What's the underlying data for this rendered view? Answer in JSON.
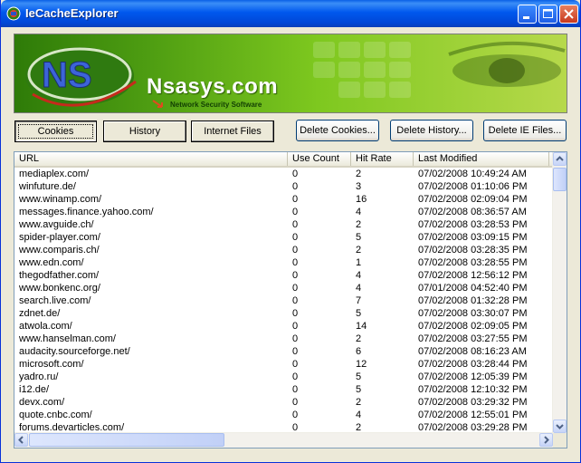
{
  "window": {
    "title": "IeCacheExplorer"
  },
  "banner": {
    "logo_text": "NS",
    "brand": "Nsasys.com",
    "tagline": "Network Security Software"
  },
  "buttons": {
    "cookies": "Cookies",
    "history": "History",
    "internet_files": "Internet Files",
    "delete_cookies": "Delete Cookies...",
    "delete_history": "Delete History...",
    "delete_ie_files": "Delete IE Files..."
  },
  "table": {
    "columns": [
      "URL",
      "Use Count",
      "Hit Rate",
      "Last Modified"
    ],
    "rows": [
      {
        "url": "mediaplex.com/",
        "use": "0",
        "hit": "2",
        "mod": "07/02/2008 10:49:24 AM"
      },
      {
        "url": "winfuture.de/",
        "use": "0",
        "hit": "3",
        "mod": "07/02/2008 01:10:06 PM"
      },
      {
        "url": "www.winamp.com/",
        "use": "0",
        "hit": "16",
        "mod": "07/02/2008 02:09:04 PM"
      },
      {
        "url": "messages.finance.yahoo.com/",
        "use": "0",
        "hit": "4",
        "mod": "07/02/2008 08:36:57 AM"
      },
      {
        "url": "www.avguide.ch/",
        "use": "0",
        "hit": "2",
        "mod": "07/02/2008 03:28:53 PM"
      },
      {
        "url": "spider-player.com/",
        "use": "0",
        "hit": "5",
        "mod": "07/02/2008 03:09:15 PM"
      },
      {
        "url": "www.comparis.ch/",
        "use": "0",
        "hit": "2",
        "mod": "07/02/2008 03:28:35 PM"
      },
      {
        "url": "www.edn.com/",
        "use": "0",
        "hit": "1",
        "mod": "07/02/2008 03:28:55 PM"
      },
      {
        "url": "thegodfather.com/",
        "use": "0",
        "hit": "4",
        "mod": "07/02/2008 12:56:12 PM"
      },
      {
        "url": "www.bonkenc.org/",
        "use": "0",
        "hit": "4",
        "mod": "07/01/2008 04:52:40 PM"
      },
      {
        "url": "search.live.com/",
        "use": "0",
        "hit": "7",
        "mod": "07/02/2008 01:32:28 PM"
      },
      {
        "url": "zdnet.de/",
        "use": "0",
        "hit": "5",
        "mod": "07/02/2008 03:30:07 PM"
      },
      {
        "url": "atwola.com/",
        "use": "0",
        "hit": "14",
        "mod": "07/02/2008 02:09:05 PM"
      },
      {
        "url": "www.hanselman.com/",
        "use": "0",
        "hit": "2",
        "mod": "07/02/2008 03:27:55 PM"
      },
      {
        "url": "audacity.sourceforge.net/",
        "use": "0",
        "hit": "6",
        "mod": "07/02/2008 08:16:23 AM"
      },
      {
        "url": "microsoft.com/",
        "use": "0",
        "hit": "12",
        "mod": "07/02/2008 03:28:44 PM"
      },
      {
        "url": "yadro.ru/",
        "use": "0",
        "hit": "5",
        "mod": "07/02/2008 12:05:39 PM"
      },
      {
        "url": "i12.de/",
        "use": "0",
        "hit": "5",
        "mod": "07/02/2008 12:10:32 PM"
      },
      {
        "url": "devx.com/",
        "use": "0",
        "hit": "2",
        "mod": "07/02/2008 03:29:32 PM"
      },
      {
        "url": "quote.cnbc.com/",
        "use": "0",
        "hit": "4",
        "mod": "07/02/2008 12:55:01 PM"
      },
      {
        "url": "forums.devarticles.com/",
        "use": "0",
        "hit": "2",
        "mod": "07/02/2008 03:29:28 PM"
      }
    ]
  },
  "icons": {
    "app": "ns-app-icon",
    "minimize": "minimize-icon",
    "maximize": "maximize-icon",
    "close": "close-icon"
  },
  "colors": {
    "titlebar": "#0058EE",
    "banner": "#5AA814",
    "list_border": "#7F9DB9"
  }
}
